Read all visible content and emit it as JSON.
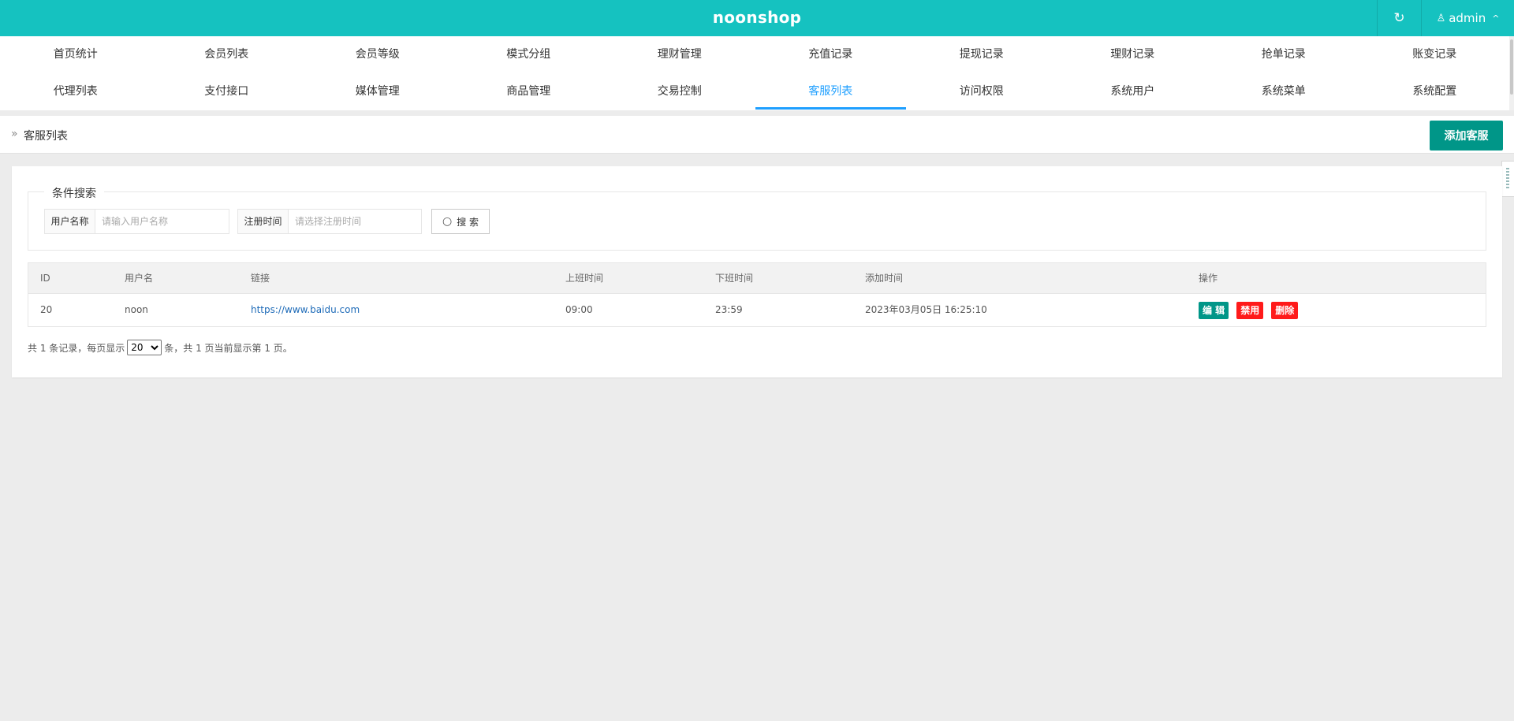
{
  "header": {
    "brand": "noonshop",
    "refresh_icon": "↻",
    "user_icon": "♙",
    "user_name": "admin",
    "user_chevron": "^"
  },
  "nav": {
    "row1": [
      "首页统计",
      "会员列表",
      "会员等级",
      "模式分组",
      "理财管理",
      "充值记录",
      "提现记录",
      "理财记录",
      "抢单记录",
      "账变记录"
    ],
    "row2": [
      "代理列表",
      "支付接口",
      "媒体管理",
      "商品管理",
      "交易控制",
      "客服列表",
      "访问权限",
      "系统用户",
      "系统菜单",
      "系统配置"
    ],
    "active": "客服列表"
  },
  "titlebar": {
    "crumb_icon": "»",
    "title": "客服列表",
    "add_button": "添加客服"
  },
  "search": {
    "legend": "条件搜索",
    "username_label": "用户名称",
    "username_placeholder": "请输入用户名称",
    "regtime_label": "注册时间",
    "regtime_placeholder": "请选择注册时间",
    "search_button": "搜 索",
    "search_icon": "○"
  },
  "table": {
    "headers": [
      "ID",
      "用户名",
      "链接",
      "上班时间",
      "下班时间",
      "添加时间",
      "操作"
    ],
    "rows": [
      {
        "id": "20",
        "username": "noon",
        "link": "https://www.baidu.com",
        "start_time": "09:00",
        "end_time": "23:59",
        "added": "2023年03月05日 16:25:10",
        "actions": {
          "edit": "编 辑",
          "disable": "禁用",
          "delete": "删除"
        }
      }
    ]
  },
  "pager": {
    "prefix": "共 1 条记录，每页显示",
    "page_size": "20",
    "suffix": "条，共 1 页当前显示第 1 页。"
  },
  "colors": {
    "header_bg": "#15c2c0",
    "accent_blue": "#1e9fff",
    "primary_green": "#009688",
    "danger_red": "#ff1a1a"
  }
}
